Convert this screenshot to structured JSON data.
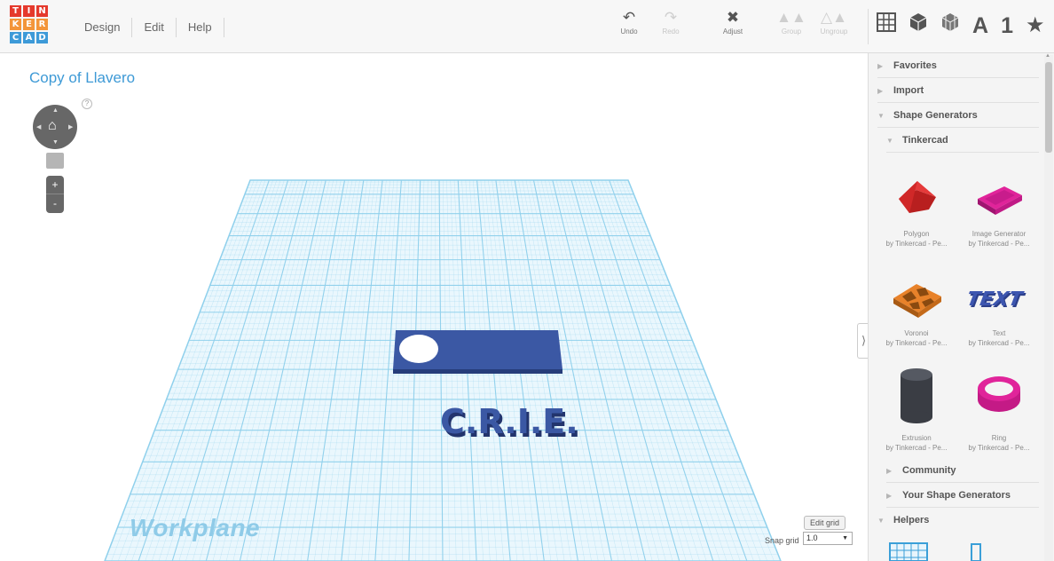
{
  "logo": {
    "rows": [
      [
        "T",
        "I",
        "N"
      ],
      [
        "K",
        "E",
        "R"
      ],
      [
        "C",
        "A",
        "D"
      ]
    ]
  },
  "menu": [
    "Design",
    "Edit",
    "Help"
  ],
  "toolbar": {
    "undo": "Undo",
    "redo": "Redo",
    "adjust": "Adjust",
    "group": "Group",
    "ungroup": "Ungroup"
  },
  "view_icons": {
    "letter": "A",
    "number": "1"
  },
  "canvas": {
    "title": "Copy of Llavero",
    "help": "?",
    "zoom_in": "+",
    "zoom_out": "-",
    "workplane_label": "Workplane",
    "object_text": "C.R.I.E.",
    "edit_grid": "Edit grid",
    "snap_label": "Snap grid",
    "snap_value": "1.0",
    "collapse": "⟩"
  },
  "sidebar": {
    "favorites": "Favorites",
    "import": "Import",
    "shape_generators": "Shape Generators",
    "tinkercad": "Tinkercad",
    "shapes": [
      {
        "name": "Polygon",
        "by": "by Tinkercad - Pe..."
      },
      {
        "name": "Image Generator",
        "by": "by Tinkercad - Pe..."
      },
      {
        "name": "Voronoi",
        "by": "by Tinkercad - Pe..."
      },
      {
        "name": "Text",
        "by": "by Tinkercad - Pe..."
      },
      {
        "name": "Extrusion",
        "by": "by Tinkercad - Pe..."
      },
      {
        "name": "Ring",
        "by": "by Tinkercad - Pe..."
      }
    ],
    "community": "Community",
    "your_shape_generators": "Your Shape Generators",
    "helpers": "Helpers"
  },
  "colors": {
    "accent": "#3e9ad6",
    "grid_line": "#8fd0ec",
    "object_blue": "#3b58a4"
  }
}
